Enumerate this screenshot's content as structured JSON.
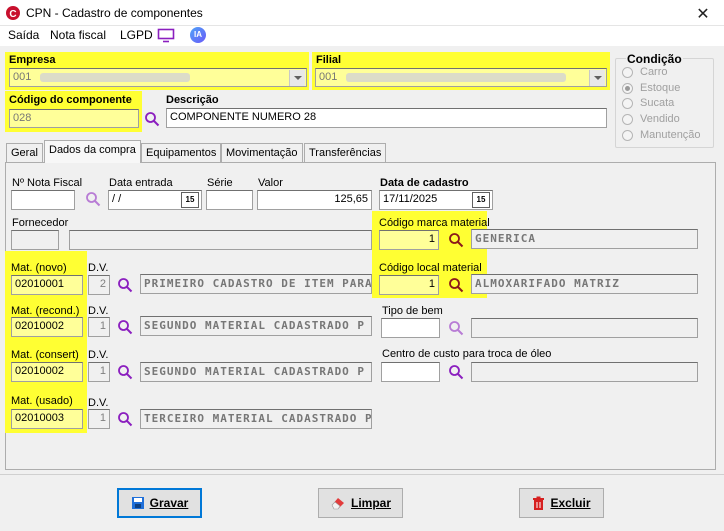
{
  "window": {
    "title": "CPN - Cadastro de componentes",
    "close_glyph": "✕"
  },
  "menu": {
    "items": [
      "Saída",
      "Nota fiscal",
      "LGPD"
    ],
    "ia_label": "IA"
  },
  "header": {
    "empresa_label": "Empresa",
    "empresa_value": "001",
    "filial_label": "Filial",
    "filial_value": "001",
    "codigo_label": "Código do componente",
    "codigo_value": "028",
    "descricao_label": "Descrição",
    "descricao_value": "COMPONENTE NUMERO 28"
  },
  "condicao": {
    "title": "Condição",
    "options": [
      "Carro",
      "Estoque",
      "Sucata",
      "Vendido",
      "Manutenção"
    ],
    "selected": "Estoque"
  },
  "tabs": [
    "Geral",
    "Dados da compra",
    "Equipamentos",
    "Movimentação",
    "Transferências"
  ],
  "active_tab": "Dados da compra",
  "compra": {
    "nota_fiscal_label": "Nº Nota Fiscal",
    "nota_fiscal_value": "",
    "data_entrada_label": "Data entrada",
    "data_entrada_value": " / /",
    "serie_label": "Série",
    "serie_value": "",
    "valor_label": "Valor",
    "valor_value": "125,65",
    "data_cadastro_label": "Data de cadastro",
    "data_cadastro_value": "17/11/2025",
    "fornecedor_label": "Fornecedor",
    "marca_label": "Código marca material",
    "marca_code": "1",
    "marca_desc": "GENERICA",
    "local_label": "Código local material",
    "local_code": "1",
    "local_desc": "ALMOXARIFADO MATRIZ",
    "tipo_bem_label": "Tipo de bem",
    "centro_custo_label": "Centro de custo para troca de óleo",
    "dv_label": "D.V.",
    "materials": [
      {
        "label": "Mat. (novo)",
        "code": "02010001",
        "dv": "2",
        "desc": "PRIMEIRO CADASTRO DE ITEM PARA"
      },
      {
        "label": "Mat. (recond.)",
        "code": "02010002",
        "dv": "1",
        "desc": "SEGUNDO MATERIAL CADASTRADO P"
      },
      {
        "label": "Mat. (consert)",
        "code": "02010002",
        "dv": "1",
        "desc": "SEGUNDO MATERIAL CADASTRADO P"
      },
      {
        "label": "Mat. (usado)",
        "code": "02010003",
        "dv": "1",
        "desc": "TERCEIRO MATERIAL CADASTRADO P"
      }
    ]
  },
  "buttons": {
    "gravar": "Gravar",
    "limpar": "Limpar",
    "excluir": "Excluir"
  },
  "colors": {
    "highlight": "#ffff33",
    "search_icon": "#8b1fbf",
    "focus": "#0078d7"
  }
}
